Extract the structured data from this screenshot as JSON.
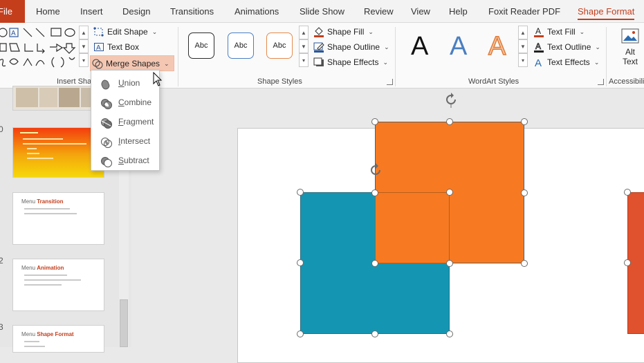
{
  "tabs": [
    {
      "id": "file",
      "label": "File"
    },
    {
      "id": "home",
      "label": "Home"
    },
    {
      "id": "insert",
      "label": "Insert"
    },
    {
      "id": "design",
      "label": "Design"
    },
    {
      "id": "transitions",
      "label": "Transitions"
    },
    {
      "id": "animations",
      "label": "Animations"
    },
    {
      "id": "slideshow",
      "label": "Slide Show"
    },
    {
      "id": "review",
      "label": "Review"
    },
    {
      "id": "view",
      "label": "View"
    },
    {
      "id": "help",
      "label": "Help"
    },
    {
      "id": "foxit",
      "label": "Foxit Reader PDF"
    },
    {
      "id": "shapeformat",
      "label": "Shape Format",
      "active": true
    }
  ],
  "ribbon": {
    "insert_shapes": {
      "label": "Insert Sha",
      "edit_shape": "Edit Shape",
      "text_box": "Text Box",
      "merge_shapes": "Merge Shapes"
    },
    "shape_styles": {
      "label": "Shape Styles",
      "preset_text": "Abc",
      "presets": [
        {
          "border": "#2b2b2b"
        },
        {
          "border": "#4a7fc1"
        },
        {
          "border": "#e58a4b"
        }
      ],
      "shape_fill": "Shape Fill",
      "shape_outline": "Shape Outline",
      "shape_effects": "Shape Effects"
    },
    "wordart_styles": {
      "label": "WordArt Styles",
      "letter": "A",
      "text_fill": "Text Fill",
      "text_outline": "Text Outline",
      "text_effects": "Text Effects"
    },
    "accessibility": {
      "label": "Accessibili",
      "alt_text_line1": "Alt",
      "alt_text_line2": "Text"
    }
  },
  "merge_menu": {
    "items": [
      {
        "id": "union",
        "key": "U",
        "rest": "nion"
      },
      {
        "id": "combine",
        "key": "C",
        "rest": "ombine"
      },
      {
        "id": "fragment",
        "key": "F",
        "rest": "ragment"
      },
      {
        "id": "intersect",
        "key": "I",
        "rest": "ntersect"
      },
      {
        "id": "subtract",
        "key": "S",
        "rest": "ubtract"
      }
    ]
  },
  "slide_panel": {
    "numbers": [
      "0",
      "2",
      "3"
    ],
    "thumbs": [
      {
        "title_prefix": "Menu ",
        "title_accent": "Transition"
      },
      {
        "title_prefix": "Menu ",
        "title_accent": "Animation"
      },
      {
        "title_prefix": "Menu ",
        "title_accent": "Shape Format"
      }
    ]
  },
  "canvas": {
    "colors": {
      "orange": "#f77a22",
      "teal": "#1496b2",
      "red_partial": "#e0522e",
      "accent": "#c43e1c"
    }
  }
}
